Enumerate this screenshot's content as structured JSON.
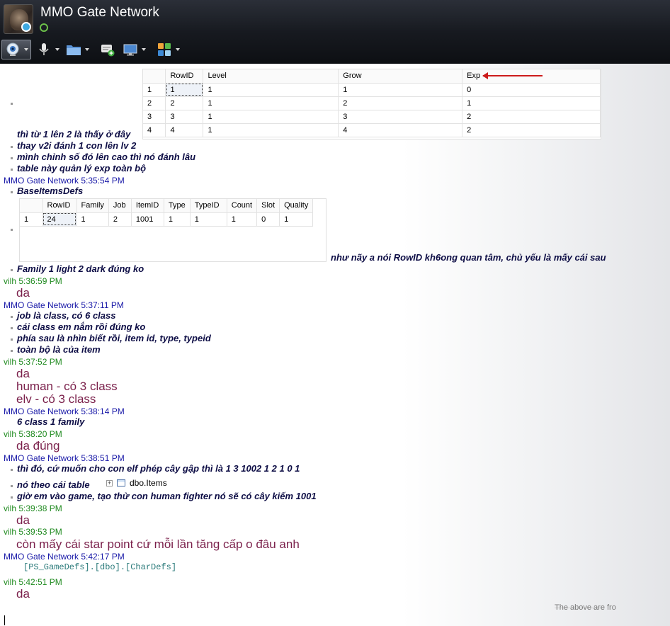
{
  "window": {
    "title": "MMO Gate Network"
  },
  "toolbar": {
    "buttons": [
      {
        "name": "webcam-button",
        "icon": "webcam-icon"
      },
      {
        "name": "microphone-button",
        "icon": "microphone-icon"
      },
      {
        "name": "send-file-button",
        "icon": "folder-icon"
      },
      {
        "name": "invite-button",
        "icon": "add-contact-icon"
      },
      {
        "name": "share-screen-button",
        "icon": "screen-icon"
      },
      {
        "name": "activities-button",
        "icon": "apps-icon"
      }
    ]
  },
  "grid1": {
    "columns": [
      "RowID",
      "Level",
      "Grow",
      "Exp"
    ],
    "rows": [
      [
        "1",
        "1",
        "1",
        "1",
        "0"
      ],
      [
        "2",
        "2",
        "1",
        "2",
        "1"
      ],
      [
        "3",
        "3",
        "1",
        "3",
        "2"
      ],
      [
        "4",
        "4",
        "1",
        "4",
        "2"
      ]
    ]
  },
  "grid2": {
    "columns": [
      "RowID",
      "Family",
      "Job",
      "ItemID",
      "Type",
      "TypeID",
      "Count",
      "Slot",
      "Quality"
    ],
    "rows": [
      [
        "1",
        "24",
        "1",
        "2",
        "1001",
        "1",
        "1",
        "1",
        "0",
        "1"
      ]
    ]
  },
  "chat": {
    "m1": "thì từ 1 lên 2 là thấy ở đây",
    "m2": "thay v2i đánh 1 con lên lv 2",
    "m3": "mình chỉnh số đó lên cao thì nó đánh lâu",
    "m4": "table này quản lý exp toàn bộ",
    "h1": "MMO Gate Network  5:35:54 PM",
    "m5": "BaseItemsDefs",
    "m6": "như nãy a nói RowID kh6ong quan tâm, chủ yếu là mấy cái sau",
    "m7": "Family 1 light 2 dark đúng ko",
    "h2": "vilh  5:36:59 PM",
    "r1": "da",
    "h3": "MMO Gate Network  5:37:11 PM",
    "m8": "job là class, có 6 class",
    "m9": "cái class em nắm rồi đúng ko",
    "m10": "phía sau là nhìn biết rồi, item id, type, typeid",
    "m11": "toàn bộ là của item",
    "h4": "vilh  5:37:52 PM",
    "r2": "da",
    "r3": "human - có 3 class",
    "r4": "elv - có 3 class",
    "h5": "MMO Gate Network  5:38:14 PM",
    "m12": "6 class 1 family",
    "h6": "vilh  5:38:20 PM",
    "r5": "da đúng",
    "h7": "MMO Gate Network  5:38:51 PM",
    "m13": "thì đó, cứ muốn cho con elf phép cây gập thì là 1 3 1002 1 2 1 0 1",
    "m14": "nó theo cái table",
    "tree_item": "dbo.Items",
    "m15": "giờ em vào game, tạo thử con human fighter nó sẽ có cây kiếm 1001",
    "h8": "vilh  5:39:38 PM",
    "r6": "da",
    "h9": "vilh  5:39:53 PM",
    "r7": "còn mấy cái star point cứ mỗi lần tăng cấp o đâu anh",
    "h10": "MMO Gate Network  5:42:17 PM",
    "code": "[PS_GameDefs].[dbo].[CharDefs]",
    "h11": "vilh  5:42:51 PM",
    "r8": "da"
  },
  "system_note": "The above are fro"
}
